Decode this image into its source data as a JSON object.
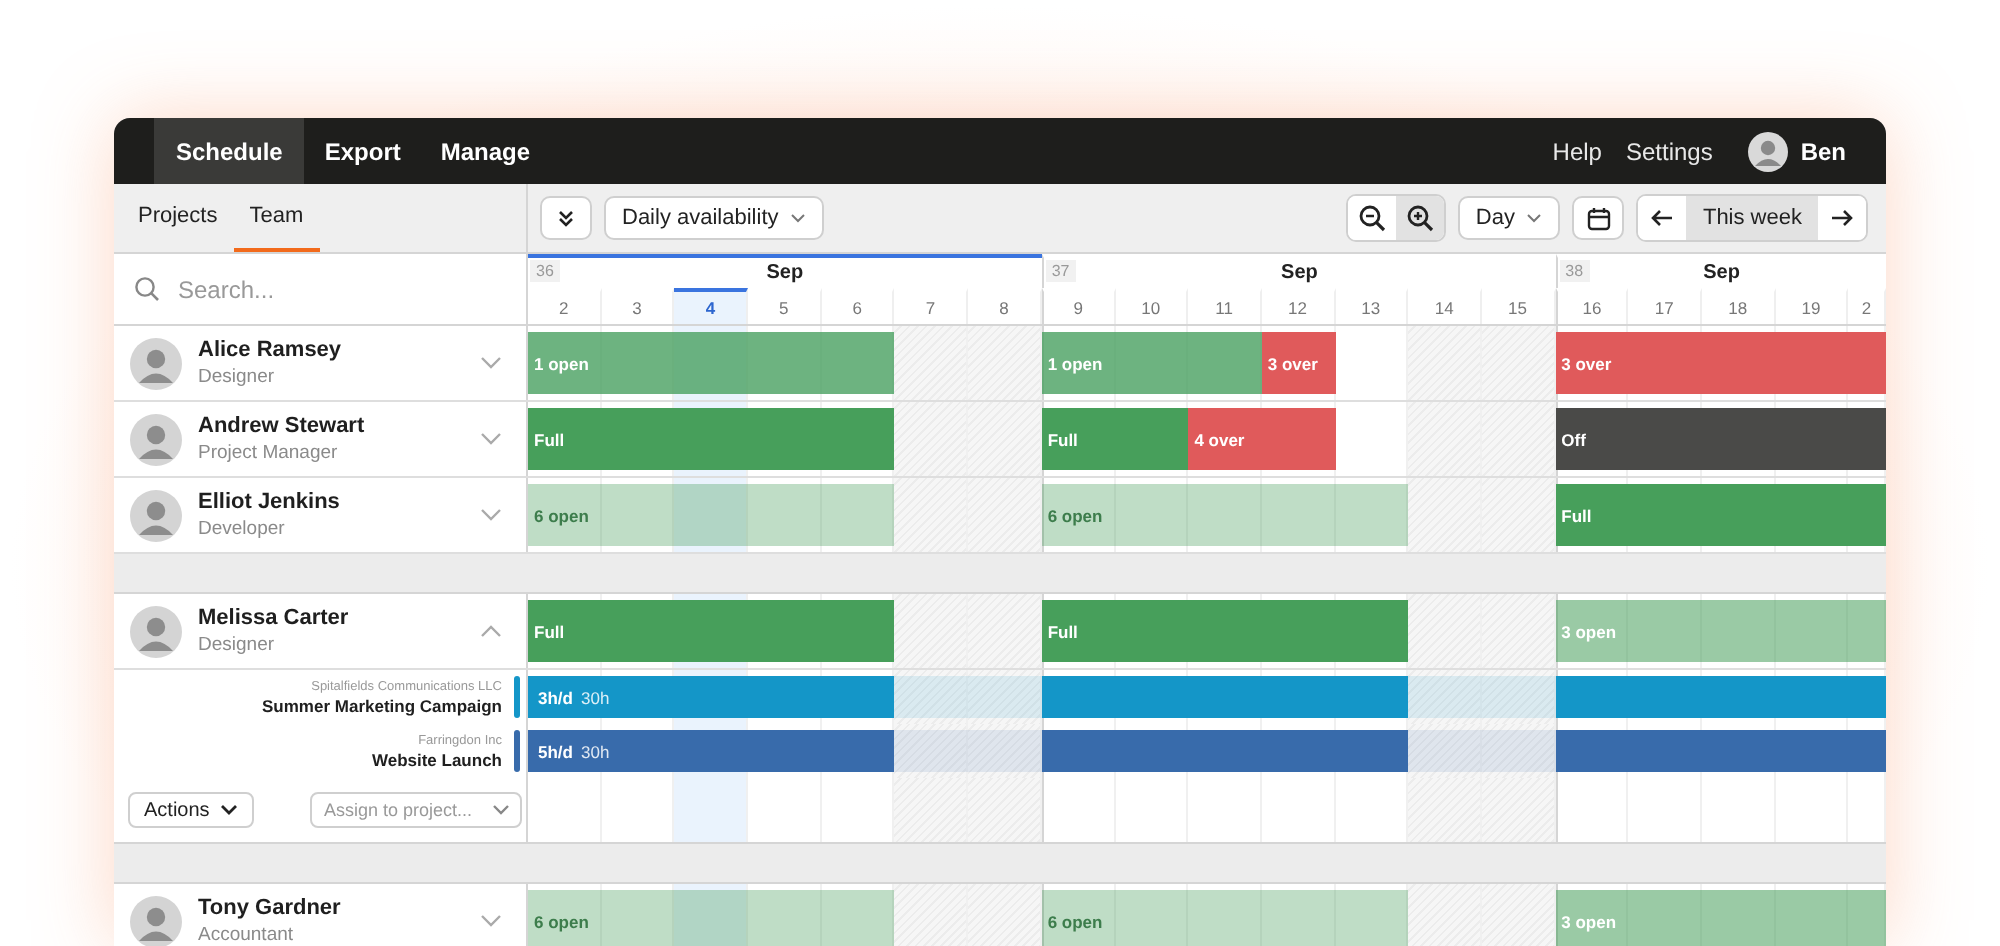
{
  "nav": {
    "items": [
      {
        "label": "Schedule",
        "selected": true
      },
      {
        "label": "Export",
        "selected": false
      },
      {
        "label": "Manage",
        "selected": false
      }
    ],
    "links": [
      "Help",
      "Settings"
    ],
    "user": {
      "name": "Ben"
    }
  },
  "view_tabs": [
    {
      "label": "Projects",
      "selected": false
    },
    {
      "label": "Team",
      "selected": true
    }
  ],
  "toolbar": {
    "availability": "Daily availability",
    "zoom": [
      {
        "kind": "out",
        "selected": false
      },
      {
        "kind": "in",
        "selected": true
      }
    ],
    "scale": "Day",
    "week": "This week"
  },
  "search": {
    "placeholder": "Search..."
  },
  "weeks": [
    {
      "number": "36",
      "month": "Sep",
      "current": true,
      "days": [
        {
          "label": "2",
          "weekend": false,
          "today": false
        },
        {
          "label": "3",
          "weekend": false,
          "today": false
        },
        {
          "label": "4",
          "weekend": false,
          "today": true
        },
        {
          "label": "5",
          "weekend": false,
          "today": false
        },
        {
          "label": "6",
          "weekend": false,
          "today": false
        },
        {
          "label": "7",
          "weekend": true,
          "today": false
        },
        {
          "label": "8",
          "weekend": true,
          "today": false
        }
      ]
    },
    {
      "number": "37",
      "month": "Sep",
      "current": false,
      "days": [
        {
          "label": "9",
          "weekend": false,
          "today": false
        },
        {
          "label": "10",
          "weekend": false,
          "today": false
        },
        {
          "label": "11",
          "weekend": false,
          "today": false
        },
        {
          "label": "12",
          "weekend": false,
          "today": false
        },
        {
          "label": "13",
          "weekend": false,
          "today": false
        },
        {
          "label": "14",
          "weekend": true,
          "today": false
        },
        {
          "label": "15",
          "weekend": true,
          "today": false
        }
      ]
    },
    {
      "number": "38",
      "month": "Sep",
      "current": false,
      "days": [
        {
          "label": "16",
          "weekend": false,
          "today": false
        },
        {
          "label": "17",
          "weekend": false,
          "today": false
        },
        {
          "label": "18",
          "weekend": false,
          "today": false
        },
        {
          "label": "19",
          "weekend": false,
          "today": false
        },
        {
          "label": "2",
          "weekend": false,
          "today": false
        }
      ]
    }
  ],
  "people": [
    {
      "name": "Alice Ramsey",
      "role": "Designer",
      "expanded": false,
      "days": [
        {
          "kind": "few",
          "label": "1 open"
        },
        {
          "kind": "few"
        },
        {
          "kind": "few"
        },
        {
          "kind": "few"
        },
        {
          "kind": "few"
        },
        {
          "kind": "none"
        },
        {
          "kind": "none"
        },
        {
          "kind": "few",
          "label": "1 open"
        },
        {
          "kind": "few"
        },
        {
          "kind": "few"
        },
        {
          "kind": "over",
          "label": "3 over"
        },
        {
          "kind": "none"
        },
        {
          "kind": "none"
        },
        {
          "kind": "none"
        },
        {
          "kind": "over",
          "label": "3 over"
        },
        {
          "kind": "over"
        },
        {
          "kind": "over"
        },
        {
          "kind": "over"
        },
        {
          "kind": "over"
        }
      ]
    },
    {
      "name": "Andrew Stewart",
      "role": "Project Manager",
      "expanded": false,
      "days": [
        {
          "kind": "full",
          "label": "Full"
        },
        {
          "kind": "full"
        },
        {
          "kind": "full"
        },
        {
          "kind": "full"
        },
        {
          "kind": "full"
        },
        {
          "kind": "none"
        },
        {
          "kind": "none"
        },
        {
          "kind": "full",
          "label": "Full"
        },
        {
          "kind": "full"
        },
        {
          "kind": "over",
          "label": "4 over"
        },
        {
          "kind": "over"
        },
        {
          "kind": "none"
        },
        {
          "kind": "none"
        },
        {
          "kind": "none"
        },
        {
          "kind": "off",
          "label": "Off"
        },
        {
          "kind": "off"
        },
        {
          "kind": "off"
        },
        {
          "kind": "off"
        },
        {
          "kind": "off"
        }
      ]
    },
    {
      "name": "Elliot Jenkins",
      "role": "Developer",
      "expanded": false,
      "days": [
        {
          "kind": "many",
          "label": "6 open"
        },
        {
          "kind": "many"
        },
        {
          "kind": "many"
        },
        {
          "kind": "many"
        },
        {
          "kind": "many"
        },
        {
          "kind": "none"
        },
        {
          "kind": "none"
        },
        {
          "kind": "many",
          "label": "6 open"
        },
        {
          "kind": "many"
        },
        {
          "kind": "many"
        },
        {
          "kind": "many"
        },
        {
          "kind": "many"
        },
        {
          "kind": "none"
        },
        {
          "kind": "none"
        },
        {
          "kind": "full",
          "label": "Full"
        },
        {
          "kind": "full"
        },
        {
          "kind": "full"
        },
        {
          "kind": "full"
        },
        {
          "kind": "full"
        }
      ]
    },
    {
      "name": "Melissa Carter",
      "role": "Designer",
      "expanded": true,
      "days": [
        {
          "kind": "full",
          "label": "Full"
        },
        {
          "kind": "full"
        },
        {
          "kind": "full"
        },
        {
          "kind": "full"
        },
        {
          "kind": "full"
        },
        {
          "kind": "none"
        },
        {
          "kind": "none"
        },
        {
          "kind": "full",
          "label": "Full"
        },
        {
          "kind": "full"
        },
        {
          "kind": "full"
        },
        {
          "kind": "full"
        },
        {
          "kind": "full"
        },
        {
          "kind": "none"
        },
        {
          "kind": "none"
        },
        {
          "kind": "some",
          "label": "3 open"
        },
        {
          "kind": "some"
        },
        {
          "kind": "some"
        },
        {
          "kind": "some"
        },
        {
          "kind": "some"
        }
      ],
      "projects": [
        {
          "client": "Spitalfields Communications LLC",
          "name": "Summer Marketing Campaign",
          "color": "#1496c8",
          "days": [
            {
              "kind": "work",
              "rate": "3h/d",
              "total": "30h"
            },
            {
              "kind": "work"
            },
            {
              "kind": "work"
            },
            {
              "kind": "work"
            },
            {
              "kind": "work"
            },
            {
              "kind": "idle"
            },
            {
              "kind": "idle"
            },
            {
              "kind": "work"
            },
            {
              "kind": "work"
            },
            {
              "kind": "work"
            },
            {
              "kind": "work"
            },
            {
              "kind": "work"
            },
            {
              "kind": "idle"
            },
            {
              "kind": "idle"
            },
            {
              "kind": "work"
            },
            {
              "kind": "work"
            },
            {
              "kind": "work"
            },
            {
              "kind": "work"
            },
            {
              "kind": "work"
            }
          ]
        },
        {
          "client": "Farringdon Inc",
          "name": "Website Launch",
          "color": "#386bab",
          "days": [
            {
              "kind": "work",
              "rate": "5h/d",
              "total": "30h"
            },
            {
              "kind": "work"
            },
            {
              "kind": "work"
            },
            {
              "kind": "work"
            },
            {
              "kind": "work"
            },
            {
              "kind": "idle"
            },
            {
              "kind": "idle"
            },
            {
              "kind": "work"
            },
            {
              "kind": "work"
            },
            {
              "kind": "work"
            },
            {
              "kind": "work"
            },
            {
              "kind": "work"
            },
            {
              "kind": "idle"
            },
            {
              "kind": "idle"
            },
            {
              "kind": "work"
            },
            {
              "kind": "work"
            },
            {
              "kind": "work"
            },
            {
              "kind": "work"
            },
            {
              "kind": "work"
            }
          ]
        }
      ],
      "actions": "Actions",
      "assign": {
        "placeholder": "Assign to project..."
      }
    },
    {
      "name": "Tony Gardner",
      "role": "Accountant",
      "expanded": false,
      "days": [
        {
          "kind": "many",
          "label": "6 open"
        },
        {
          "kind": "many"
        },
        {
          "kind": "many"
        },
        {
          "kind": "many"
        },
        {
          "kind": "many"
        },
        {
          "kind": "none"
        },
        {
          "kind": "none"
        },
        {
          "kind": "many",
          "label": "6 open"
        },
        {
          "kind": "many"
        },
        {
          "kind": "many"
        },
        {
          "kind": "many"
        },
        {
          "kind": "many"
        },
        {
          "kind": "none"
        },
        {
          "kind": "none"
        },
        {
          "kind": "some",
          "label": "3 open"
        },
        {
          "kind": "some"
        },
        {
          "kind": "some"
        },
        {
          "kind": "some"
        },
        {
          "kind": "some"
        }
      ]
    }
  ]
}
